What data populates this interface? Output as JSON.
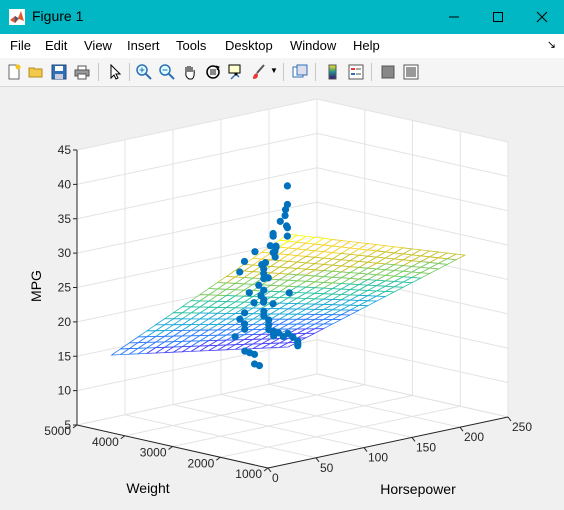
{
  "window": {
    "title": "Figure 1"
  },
  "menu": {
    "items": [
      "File",
      "Edit",
      "View",
      "Insert",
      "Tools",
      "Desktop",
      "Window",
      "Help"
    ]
  },
  "toolbar": {
    "icons": [
      "new-figure-icon",
      "open-file-icon",
      "save-icon",
      "print-icon",
      "pointer-icon",
      "zoom-in-icon",
      "zoom-out-icon",
      "pan-icon",
      "rotate-3d-icon",
      "data-cursor-icon",
      "brush-icon",
      "link-plot-icon",
      "colorbar-icon",
      "legend-icon",
      "hide-plot-tools-icon",
      "show-plot-tools-icon"
    ]
  },
  "colors": {
    "titlebar": "#00b7c3",
    "marker": "#0072bd"
  },
  "chart_data": {
    "type": "scatter",
    "xlabel": "Weight",
    "ylabel": "Horsepower",
    "zlabel": "MPG",
    "xlim": [
      1000,
      5000
    ],
    "ylim": [
      0,
      250
    ],
    "zlim": [
      5,
      45
    ],
    "xticks": [
      1000,
      2000,
      3000,
      4000,
      5000
    ],
    "yticks": [
      0,
      50,
      100,
      150,
      200,
      250
    ],
    "zticks": [
      5,
      10,
      15,
      20,
      25,
      30,
      35,
      40,
      45
    ],
    "grid": true,
    "surface": {
      "x_range": [
        1500,
        5200
      ],
      "y_range": [
        46,
        230
      ],
      "z_model": "z = 48.9 - 0.0066*Weight - 0.0556*Horsepower + 0.0000062*Weight*Horsepower"
    },
    "points": [
      {
        "x": 1800,
        "y": 60,
        "z": 43
      },
      {
        "x": 1900,
        "y": 65,
        "z": 40
      },
      {
        "x": 2000,
        "y": 68,
        "z": 39
      },
      {
        "x": 2050,
        "y": 70,
        "z": 38
      },
      {
        "x": 2150,
        "y": 70,
        "z": 37
      },
      {
        "x": 2100,
        "y": 75,
        "z": 36
      },
      {
        "x": 2200,
        "y": 79,
        "z": 36
      },
      {
        "x": 2300,
        "y": 70,
        "z": 35
      },
      {
        "x": 2400,
        "y": 72,
        "z": 33
      },
      {
        "x": 2500,
        "y": 80,
        "z": 34
      },
      {
        "x": 2600,
        "y": 88,
        "z": 32
      },
      {
        "x": 2700,
        "y": 90,
        "z": 31
      },
      {
        "x": 2800,
        "y": 97,
        "z": 30
      },
      {
        "x": 2900,
        "y": 88,
        "z": 29
      },
      {
        "x": 3000,
        "y": 95,
        "z": 28
      },
      {
        "x": 3100,
        "y": 100,
        "z": 27
      },
      {
        "x": 3200,
        "y": 105,
        "z": 26
      },
      {
        "x": 3300,
        "y": 110,
        "z": 24
      },
      {
        "x": 3400,
        "y": 112,
        "z": 23
      },
      {
        "x": 3500,
        "y": 120,
        "z": 22
      },
      {
        "x": 3600,
        "y": 125,
        "z": 20
      },
      {
        "x": 3700,
        "y": 130,
        "z": 19
      },
      {
        "x": 3800,
        "y": 140,
        "z": 18
      },
      {
        "x": 3900,
        "y": 145,
        "z": 17
      },
      {
        "x": 4000,
        "y": 150,
        "z": 16
      },
      {
        "x": 4100,
        "y": 160,
        "z": 15
      },
      {
        "x": 4200,
        "y": 165,
        "z": 15
      },
      {
        "x": 4300,
        "y": 170,
        "z": 14
      },
      {
        "x": 4400,
        "y": 180,
        "z": 14
      },
      {
        "x": 4500,
        "y": 190,
        "z": 13
      },
      {
        "x": 4600,
        "y": 200,
        "z": 13
      },
      {
        "x": 4700,
        "y": 210,
        "z": 12
      },
      {
        "x": 4800,
        "y": 220,
        "z": 11
      },
      {
        "x": 4900,
        "y": 225,
        "z": 10
      },
      {
        "x": 5000,
        "y": 230,
        "z": 10
      },
      {
        "x": 2200,
        "y": 60,
        "z": 29
      },
      {
        "x": 2400,
        "y": 65,
        "z": 25
      },
      {
        "x": 2600,
        "y": 70,
        "z": 27
      },
      {
        "x": 2800,
        "y": 75,
        "z": 24
      },
      {
        "x": 3000,
        "y": 80,
        "z": 25
      },
      {
        "x": 3200,
        "y": 85,
        "z": 20
      },
      {
        "x": 3400,
        "y": 95,
        "z": 21
      },
      {
        "x": 3600,
        "y": 105,
        "z": 18
      },
      {
        "x": 3800,
        "y": 110,
        "z": 19
      },
      {
        "x": 4000,
        "y": 115,
        "z": 16
      },
      {
        "x": 4200,
        "y": 135,
        "z": 13
      },
      {
        "x": 4400,
        "y": 150,
        "z": 12
      },
      {
        "x": 4600,
        "y": 165,
        "z": 11
      },
      {
        "x": 4800,
        "y": 175,
        "z": 9
      },
      {
        "x": 5000,
        "y": 190,
        "z": 8
      },
      {
        "x": 1700,
        "y": 55,
        "z": 36
      },
      {
        "x": 2000,
        "y": 58,
        "z": 34
      },
      {
        "x": 2300,
        "y": 62,
        "z": 31
      },
      {
        "x": 2600,
        "y": 66,
        "z": 32
      },
      {
        "x": 2900,
        "y": 70,
        "z": 30
      },
      {
        "x": 3100,
        "y": 75,
        "z": 28
      },
      {
        "x": 1600,
        "y": 52,
        "z": 28
      },
      {
        "x": 1900,
        "y": 50,
        "z": 26
      },
      {
        "x": 2100,
        "y": 62,
        "z": 33
      }
    ]
  }
}
